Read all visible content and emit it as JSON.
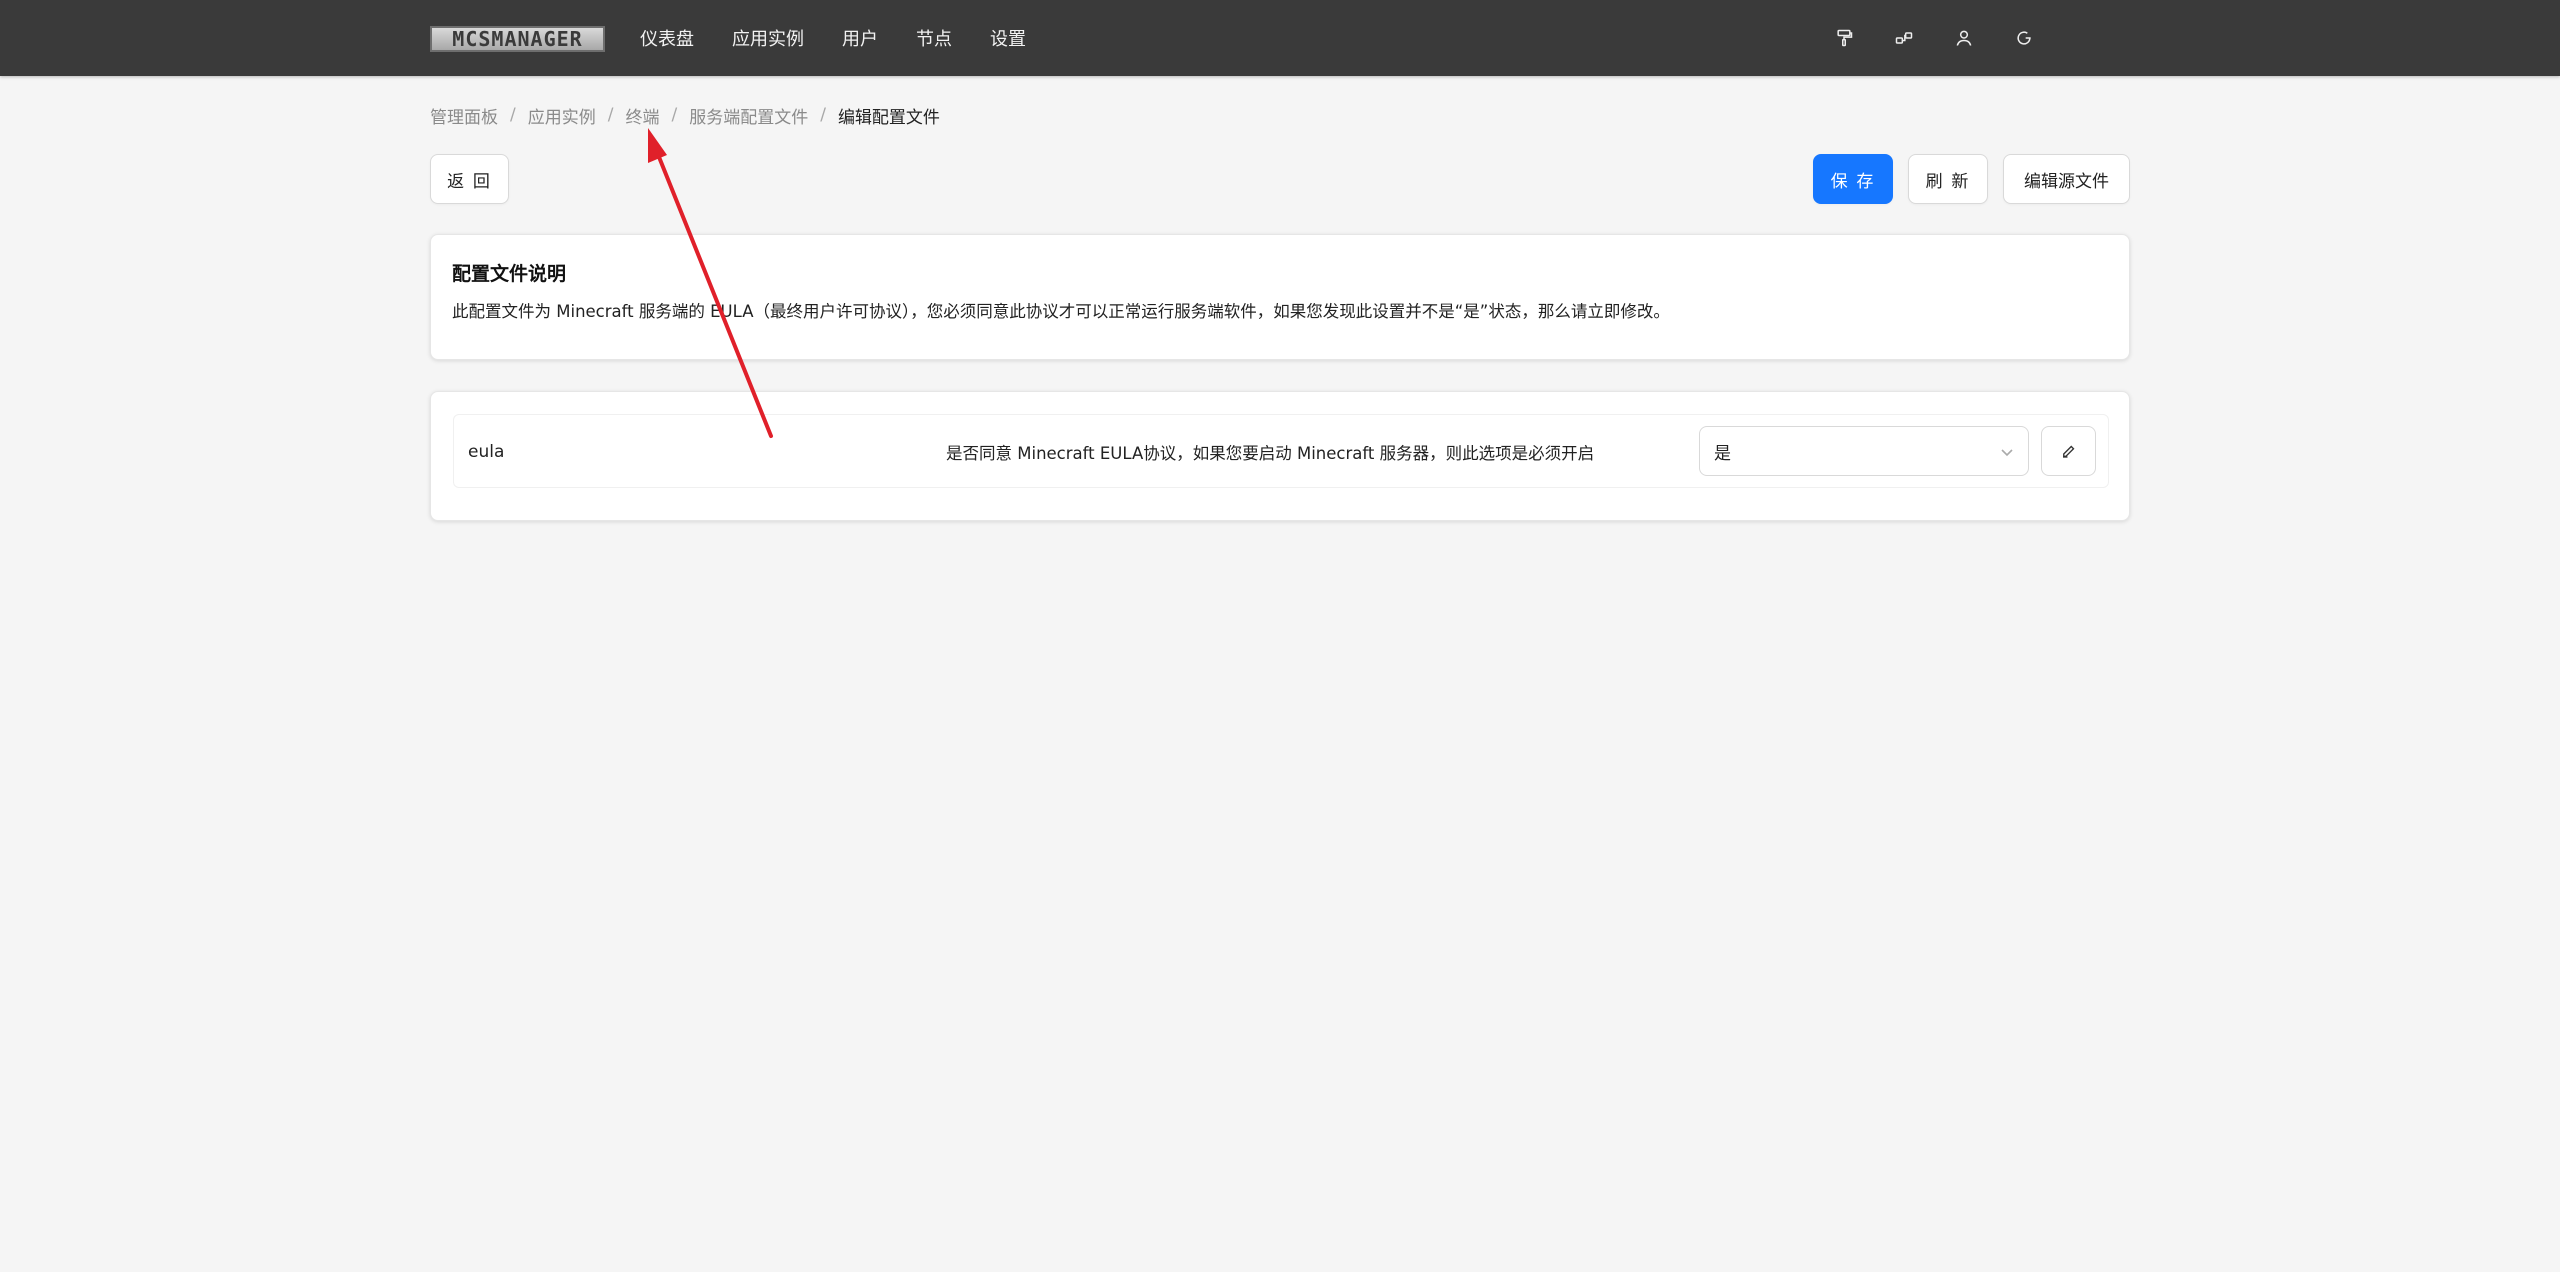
{
  "header": {
    "logo_text": "MCSMANAGER",
    "nav": [
      "仪表盘",
      "应用实例",
      "用户",
      "节点",
      "设置"
    ],
    "icons": [
      "paint-roller-icon",
      "nodes-icon",
      "user-icon",
      "logout-icon"
    ]
  },
  "breadcrumb": {
    "items": [
      "管理面板",
      "应用实例",
      "终端",
      "服务端配置文件"
    ],
    "current": "编辑配置文件",
    "separator": "/"
  },
  "actions": {
    "back_label": "返 回",
    "save_label": "保 存",
    "refresh_label": "刷 新",
    "edit_source_label": "编辑源文件"
  },
  "description_card": {
    "title": "配置文件说明",
    "text": "此配置文件为 Minecraft 服务端的 EULA（最终用户许可协议），您必须同意此协议才可以正常运行服务端软件，如果您发现此设置并不是“是”状态，那么请立即修改。"
  },
  "config": {
    "rows": [
      {
        "key": "eula",
        "description": "是否同意 Minecraft EULA协议，如果您要启动 Minecraft 服务器，则此选项是必须开启",
        "value": "是"
      }
    ]
  },
  "colors": {
    "header_bg": "#3a3a3a",
    "primary": "#1677ff",
    "annotation_arrow": "#e0202a"
  }
}
